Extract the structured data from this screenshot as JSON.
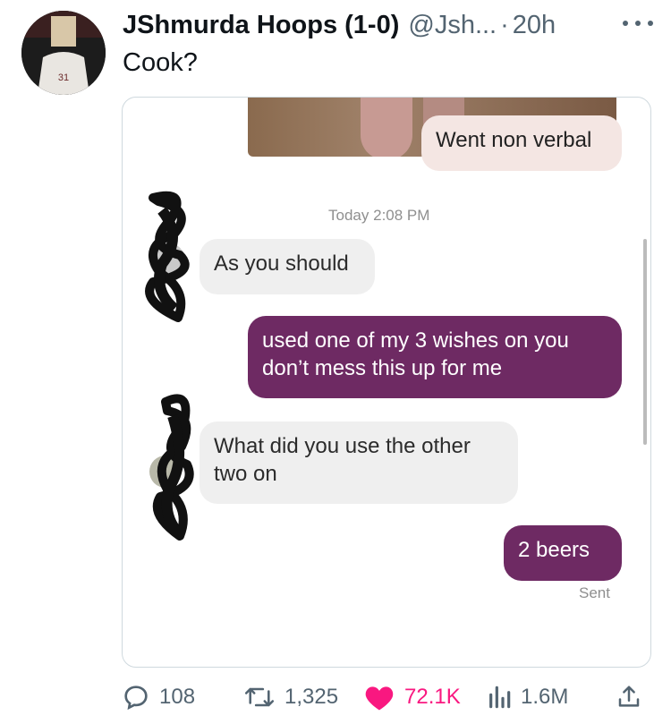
{
  "tweet": {
    "author_name": "JShmurda Hoops (1-0)",
    "handle": "@Jsh...",
    "separator": "·",
    "time": "20h",
    "text": "Cook?",
    "avatar_jersey_text": "31"
  },
  "conversation": {
    "messages": [
      {
        "direction": "outgoing",
        "text": "Went non verbal"
      },
      {
        "direction": "incoming",
        "text": "As you should"
      },
      {
        "direction": "outgoing",
        "text": "used one of my 3 wishes on you don’t mess this up for me"
      },
      {
        "direction": "incoming",
        "text": "What did you use the other two on"
      },
      {
        "direction": "outgoing",
        "text": "2 beers"
      }
    ],
    "timestamp_label": "Today",
    "timestamp_time": "2:08 PM",
    "status": "Sent"
  },
  "actions": {
    "replies": "108",
    "reposts": "1,325",
    "likes": "72.1K",
    "views": "1.6M"
  },
  "colors": {
    "outgoing_bubble": "#6e2a63",
    "incoming_bubble": "#efefef",
    "like": "#f91880",
    "muted": "#536471"
  }
}
